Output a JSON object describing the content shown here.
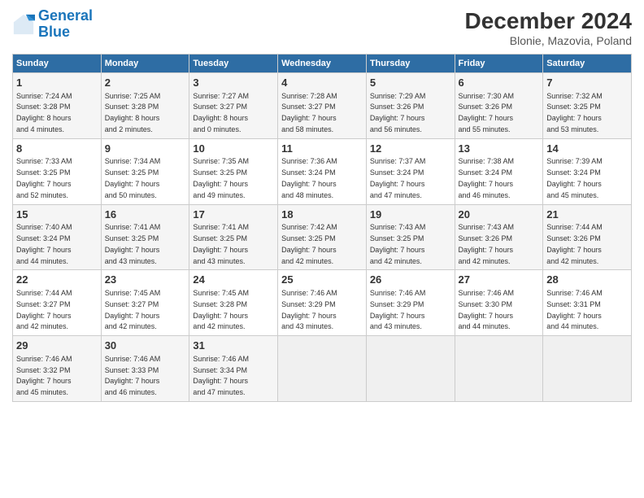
{
  "logo": {
    "line1": "General",
    "line2": "Blue"
  },
  "title": "December 2024",
  "subtitle": "Blonie, Mazovia, Poland",
  "days": [
    "Sunday",
    "Monday",
    "Tuesday",
    "Wednesday",
    "Thursday",
    "Friday",
    "Saturday"
  ],
  "weeks": [
    [
      {
        "day": "1",
        "sunrise": "7:24 AM",
        "sunset": "3:28 PM",
        "daylight": "8 hours and 4 minutes."
      },
      {
        "day": "2",
        "sunrise": "7:25 AM",
        "sunset": "3:28 PM",
        "daylight": "8 hours and 2 minutes."
      },
      {
        "day": "3",
        "sunrise": "7:27 AM",
        "sunset": "3:27 PM",
        "daylight": "8 hours and 0 minutes."
      },
      {
        "day": "4",
        "sunrise": "7:28 AM",
        "sunset": "3:27 PM",
        "daylight": "7 hours and 58 minutes."
      },
      {
        "day": "5",
        "sunrise": "7:29 AM",
        "sunset": "3:26 PM",
        "daylight": "7 hours and 56 minutes."
      },
      {
        "day": "6",
        "sunrise": "7:30 AM",
        "sunset": "3:26 PM",
        "daylight": "7 hours and 55 minutes."
      },
      {
        "day": "7",
        "sunrise": "7:32 AM",
        "sunset": "3:25 PM",
        "daylight": "7 hours and 53 minutes."
      }
    ],
    [
      {
        "day": "8",
        "sunrise": "7:33 AM",
        "sunset": "3:25 PM",
        "daylight": "7 hours and 52 minutes."
      },
      {
        "day": "9",
        "sunrise": "7:34 AM",
        "sunset": "3:25 PM",
        "daylight": "7 hours and 50 minutes."
      },
      {
        "day": "10",
        "sunrise": "7:35 AM",
        "sunset": "3:25 PM",
        "daylight": "7 hours and 49 minutes."
      },
      {
        "day": "11",
        "sunrise": "7:36 AM",
        "sunset": "3:24 PM",
        "daylight": "7 hours and 48 minutes."
      },
      {
        "day": "12",
        "sunrise": "7:37 AM",
        "sunset": "3:24 PM",
        "daylight": "7 hours and 47 minutes."
      },
      {
        "day": "13",
        "sunrise": "7:38 AM",
        "sunset": "3:24 PM",
        "daylight": "7 hours and 46 minutes."
      },
      {
        "day": "14",
        "sunrise": "7:39 AM",
        "sunset": "3:24 PM",
        "daylight": "7 hours and 45 minutes."
      }
    ],
    [
      {
        "day": "15",
        "sunrise": "7:40 AM",
        "sunset": "3:24 PM",
        "daylight": "7 hours and 44 minutes."
      },
      {
        "day": "16",
        "sunrise": "7:41 AM",
        "sunset": "3:25 PM",
        "daylight": "7 hours and 43 minutes."
      },
      {
        "day": "17",
        "sunrise": "7:41 AM",
        "sunset": "3:25 PM",
        "daylight": "7 hours and 43 minutes."
      },
      {
        "day": "18",
        "sunrise": "7:42 AM",
        "sunset": "3:25 PM",
        "daylight": "7 hours and 42 minutes."
      },
      {
        "day": "19",
        "sunrise": "7:43 AM",
        "sunset": "3:25 PM",
        "daylight": "7 hours and 42 minutes."
      },
      {
        "day": "20",
        "sunrise": "7:43 AM",
        "sunset": "3:26 PM",
        "daylight": "7 hours and 42 minutes."
      },
      {
        "day": "21",
        "sunrise": "7:44 AM",
        "sunset": "3:26 PM",
        "daylight": "7 hours and 42 minutes."
      }
    ],
    [
      {
        "day": "22",
        "sunrise": "7:44 AM",
        "sunset": "3:27 PM",
        "daylight": "7 hours and 42 minutes."
      },
      {
        "day": "23",
        "sunrise": "7:45 AM",
        "sunset": "3:27 PM",
        "daylight": "7 hours and 42 minutes."
      },
      {
        "day": "24",
        "sunrise": "7:45 AM",
        "sunset": "3:28 PM",
        "daylight": "7 hours and 42 minutes."
      },
      {
        "day": "25",
        "sunrise": "7:46 AM",
        "sunset": "3:29 PM",
        "daylight": "7 hours and 43 minutes."
      },
      {
        "day": "26",
        "sunrise": "7:46 AM",
        "sunset": "3:29 PM",
        "daylight": "7 hours and 43 minutes."
      },
      {
        "day": "27",
        "sunrise": "7:46 AM",
        "sunset": "3:30 PM",
        "daylight": "7 hours and 44 minutes."
      },
      {
        "day": "28",
        "sunrise": "7:46 AM",
        "sunset": "3:31 PM",
        "daylight": "7 hours and 44 minutes."
      }
    ],
    [
      {
        "day": "29",
        "sunrise": "7:46 AM",
        "sunset": "3:32 PM",
        "daylight": "7 hours and 45 minutes."
      },
      {
        "day": "30",
        "sunrise": "7:46 AM",
        "sunset": "3:33 PM",
        "daylight": "7 hours and 46 minutes."
      },
      {
        "day": "31",
        "sunrise": "7:46 AM",
        "sunset": "3:34 PM",
        "daylight": "7 hours and 47 minutes."
      },
      null,
      null,
      null,
      null
    ]
  ]
}
